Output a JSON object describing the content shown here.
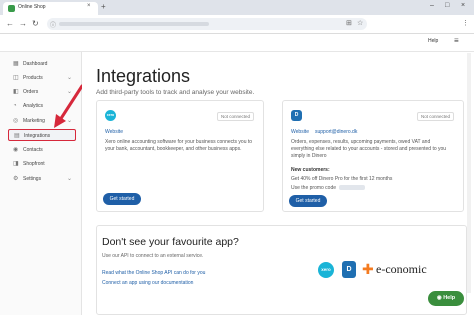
{
  "browser": {
    "tab_title": "Online Shop",
    "tab_close": "×",
    "new_tab": "+",
    "win_min": "–",
    "win_max": "□",
    "win_close": "×",
    "back": "←",
    "forward": "→",
    "reload": "↻",
    "omni_lock": "ⓘ",
    "translate_icon": "⊞",
    "star_icon": "☆",
    "menu_icon": "⋮"
  },
  "app_header": {
    "help_label": "Help",
    "menu_icon": "≡"
  },
  "sidebar": {
    "items": [
      {
        "label": "Dashboard",
        "icon": "▦",
        "chevron": ""
      },
      {
        "label": "Products",
        "icon": "◫",
        "chevron": "⌄"
      },
      {
        "label": "Orders",
        "icon": "◧",
        "chevron": "⌄"
      },
      {
        "label": "Analytics",
        "icon": "◔",
        "chevron": ""
      },
      {
        "label": "Marketing",
        "icon": "◎",
        "chevron": "⌄"
      },
      {
        "label": "Integrations",
        "icon": "▤",
        "chevron": ""
      },
      {
        "label": "Contacts",
        "icon": "◉",
        "chevron": ""
      },
      {
        "label": "Shopfront",
        "icon": "◨",
        "chevron": ""
      },
      {
        "label": "Settings",
        "icon": "⚙",
        "chevron": "⌄"
      }
    ]
  },
  "main": {
    "title": "Integrations",
    "subtitle": "Add third-party tools to track and analyse your website.",
    "cards": [
      {
        "logo": "xero",
        "status": "Not connected",
        "website_link": "Website",
        "description": "Xero online accounting software for your business connects you to your bank, accountant, bookkeeper, and other business apps.",
        "button": "Get started"
      },
      {
        "logo": "D",
        "status": "Not connected",
        "website_link": "Website",
        "email_link": "support@dinero.dk",
        "description": "Orders, expenses, results, upcoming payments, owed VAT and everything else related to your accounts - stored and presented to you simply in Dinero",
        "new_customers_label": "New customers:",
        "offer": "Get 40% off Dinero Pro for the first 12 months",
        "promo_label": "Use the promo code",
        "button": "Get started"
      }
    ],
    "missing_app": {
      "title": "Don't see your favourite app?",
      "subtitle": "Use our API to connect to an external service.",
      "link1": "Read what the Online Shop API can do for you",
      "link2": "Connect an app using our documentation",
      "partner_logos": [
        "xero",
        "D",
        "e-conomic"
      ]
    }
  },
  "help_fab": {
    "label": "Help"
  },
  "colors": {
    "accent": "#1f5fa7",
    "highlight": "#d6283b",
    "help_fab": "#3a8e3d",
    "xero": "#1ab4d7",
    "economic": "#f47b20"
  }
}
